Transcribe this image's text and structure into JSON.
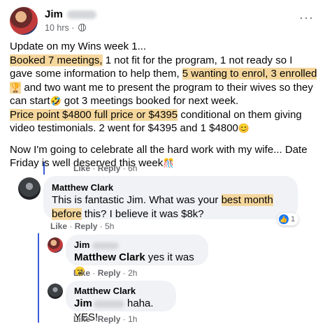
{
  "post": {
    "author": "Jim",
    "time": "10 hrs",
    "separator": "·",
    "more": "···",
    "p1_line1": "Update on my Wins week 1...",
    "p1_hl1": "Booked 7 meetings,",
    "p1_t1": " 1 not fit for the program, 1 not ready so I gave some information to help them, ",
    "p1_hl2": "5 wanting to enrol, 3 enrolled",
    "p1_emoji1": "🏆",
    "p1_t2": " and two want me to present the program to their wives so they can start",
    "p1_emoji2": "🤣",
    "p1_t3": " got 3 meetings booked for next week.",
    "p1_hl3": "Price point $4800 full price or $4395",
    "p1_t4": " conditional on them giving video testimonials. 2 went for $4395 and 1 $4800",
    "p1_emoji3": "😊",
    "p2": "Now I'm going to celebrate all the hard work with my wife... Date Friday is well deserved this week",
    "p2_emoji": "🎊"
  },
  "post_actions": {
    "like": "Like",
    "reply": "Reply",
    "time": "6h",
    "sep": "·"
  },
  "comment1": {
    "name": "Matthew Clark",
    "t1": "This is fantastic Jim. What was your ",
    "hl": "best month before",
    "t2": " this? I believe it was $8k?",
    "reaction_count": "1",
    "like": "Like",
    "reply": "Reply",
    "time": "5h",
    "sep": "·"
  },
  "reply1": {
    "name": "Jim",
    "mention": "Matthew Clark",
    "text": " yes it was ",
    "emoji": "😮",
    "like": "Like",
    "reply": "Reply",
    "time": "2h",
    "sep": "·"
  },
  "reply2": {
    "name": "Matthew Clark",
    "mention": "Jim",
    "text": " haha. YES!",
    "like": "Like",
    "reply": "Reply",
    "time": "1h",
    "sep": "·"
  },
  "colors": {
    "highlight": "#f5d79d",
    "bubble": "#f0f2f5",
    "thread": "#3b5bdb",
    "meta": "#65676b"
  }
}
